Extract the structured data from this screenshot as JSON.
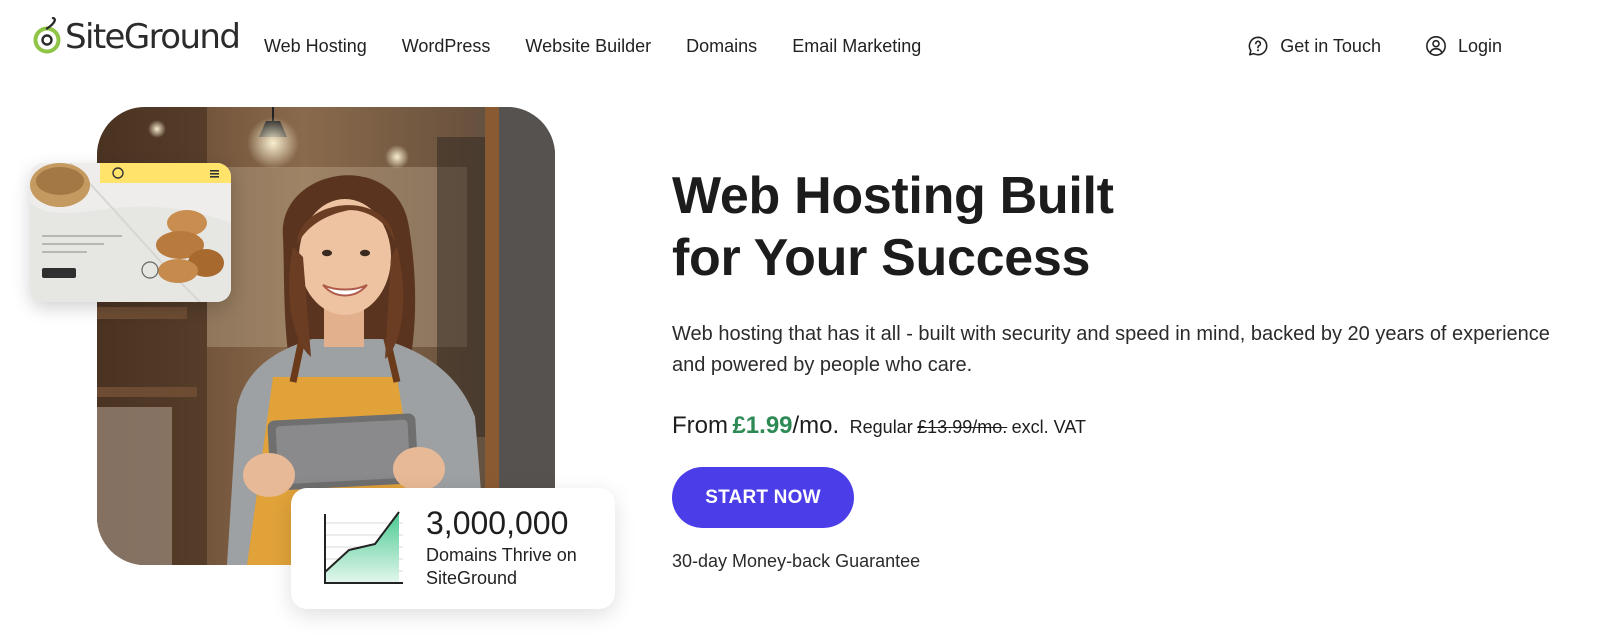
{
  "brand": {
    "name": "SiteGround",
    "accent_color": "#8fc447"
  },
  "nav": {
    "items": [
      "Web Hosting",
      "WordPress",
      "Website Builder",
      "Domains",
      "Email Marketing"
    ],
    "contact_label": "Get in Touch",
    "contact_icon": "help-circle-icon",
    "login_label": "Login",
    "login_icon": "user-circle-icon"
  },
  "hero": {
    "headline_line1": "Web Hosting Built",
    "headline_line2": "for Your Success",
    "subtext": "Web hosting that has it all - built with security and speed in mind, backed by 20 years of experience and powered by people who care.",
    "price": {
      "from": "From",
      "amount": "£1.99",
      "per": "/mo.",
      "regular_label": "Regular",
      "regular_price": "£13.99/mo.",
      "vat": "excl. VAT",
      "amount_color": "#2e8a55"
    },
    "cta_label": "START NOW",
    "cta_color": "#4b3de8",
    "guarantee": "30-day Money-back Guarantee"
  },
  "stats": {
    "number": "3,000,000",
    "caption": "Domains Thrive on SiteGround",
    "graph_icon": "growth-chart-icon"
  }
}
